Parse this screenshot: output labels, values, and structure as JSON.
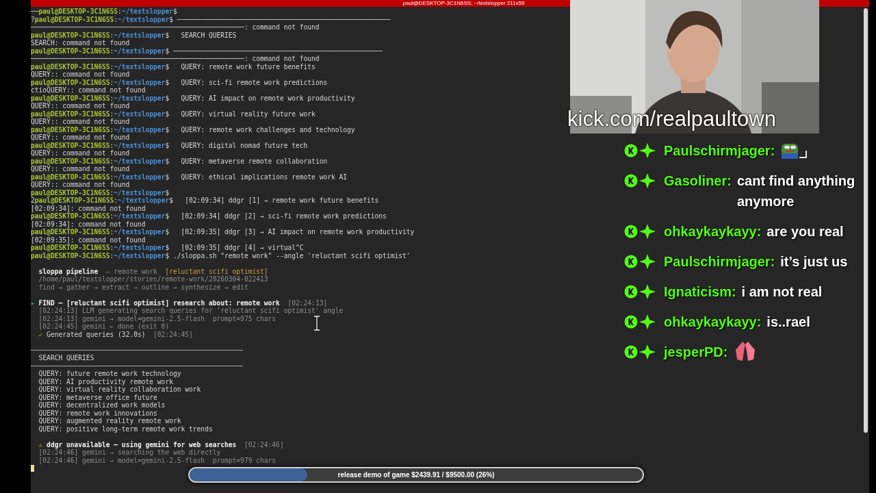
{
  "terminal": {
    "title": "paul@DESKTOP-3C1N6SS: ~/textslopper 211x59",
    "lines": [
      {
        "kind": "text",
        "spans": [
          {
            "kind": "plain",
            "text": "──"
          },
          {
            "kind": "user",
            "text": "paul@DESKTOP-3C1N6SS"
          },
          {
            "kind": "plain",
            "text": ":"
          },
          {
            "kind": "path",
            "text": "~/textslopper"
          },
          {
            "kind": "plain",
            "text": "$"
          }
        ]
      },
      {
        "kind": "text",
        "spans": [
          {
            "kind": "plain",
            "text": "?"
          },
          {
            "kind": "user",
            "text": "paul@DESKTOP-3C1N6SS"
          },
          {
            "kind": "plain",
            "text": ":"
          },
          {
            "kind": "path",
            "text": "~/textslopper"
          },
          {
            "kind": "plain",
            "text": "$ ──────────────────────────────────────────────────────"
          }
        ]
      },
      {
        "kind": "text",
        "spans": [
          {
            "kind": "plain",
            "text": "──────────────────────────────────────────────────────: command not found"
          }
        ]
      },
      {
        "kind": "text",
        "spans": [
          {
            "kind": "user",
            "text": "paul@DESKTOP-3C1N6SS"
          },
          {
            "kind": "plain",
            "text": ":"
          },
          {
            "kind": "path",
            "text": "~/textslopper"
          },
          {
            "kind": "plain",
            "text": "$   SEARCH QUERIES"
          }
        ]
      },
      {
        "kind": "text",
        "spans": [
          {
            "kind": "plain",
            "text": "SEARCH: command not found"
          }
        ]
      },
      {
        "kind": "text",
        "spans": [
          {
            "kind": "user",
            "text": "paul@DESKTOP-3C1N6SS"
          },
          {
            "kind": "plain",
            "text": ":"
          },
          {
            "kind": "path",
            "text": "~/textslopper"
          },
          {
            "kind": "plain",
            "text": "$ ─────────────────────────────────────────────────────"
          }
        ]
      },
      {
        "kind": "text",
        "spans": [
          {
            "kind": "plain",
            "text": "──────────────────────────────────────────────────────: command not found"
          }
        ]
      },
      {
        "kind": "text",
        "spans": [
          {
            "kind": "user",
            "text": "paul@DESKTOP-3C1N6SS"
          },
          {
            "kind": "plain",
            "text": ":"
          },
          {
            "kind": "path",
            "text": "~/textslopper"
          },
          {
            "kind": "plain",
            "text": "$   QUERY: remote work future benefits"
          }
        ]
      },
      {
        "kind": "text",
        "spans": [
          {
            "kind": "plain",
            "text": "QUERY:: command not found"
          }
        ]
      },
      {
        "kind": "text",
        "spans": [
          {
            "kind": "user",
            "text": "paul@DESKTOP-3C1N6SS"
          },
          {
            "kind": "plain",
            "text": ":"
          },
          {
            "kind": "path",
            "text": "~/textslopper"
          },
          {
            "kind": "plain",
            "text": "$   QUERY: sci-fi remote work predictions"
          }
        ]
      },
      {
        "kind": "text",
        "spans": [
          {
            "kind": "plain",
            "text": "ctioQUERY:: command not found"
          }
        ]
      },
      {
        "kind": "text",
        "spans": [
          {
            "kind": "user",
            "text": "paul@DESKTOP-3C1N6SS"
          },
          {
            "kind": "plain",
            "text": ":"
          },
          {
            "kind": "path",
            "text": "~/textslopper"
          },
          {
            "kind": "plain",
            "text": "$   QUERY: AI impact on remote work productivity"
          }
        ]
      },
      {
        "kind": "text",
        "spans": [
          {
            "kind": "plain",
            "text": "QUERY:: command not found"
          }
        ]
      },
      {
        "kind": "text",
        "spans": [
          {
            "kind": "user",
            "text": "paul@DESKTOP-3C1N6SS"
          },
          {
            "kind": "plain",
            "text": ":"
          },
          {
            "kind": "path",
            "text": "~/textslopper"
          },
          {
            "kind": "plain",
            "text": "$   QUERY: virtual reality future work"
          }
        ]
      },
      {
        "kind": "text",
        "spans": [
          {
            "kind": "plain",
            "text": "QUERY:: command not found"
          }
        ]
      },
      {
        "kind": "text",
        "spans": [
          {
            "kind": "user",
            "text": "paul@DESKTOP-3C1N6SS"
          },
          {
            "kind": "plain",
            "text": ":"
          },
          {
            "kind": "path",
            "text": "~/textslopper"
          },
          {
            "kind": "plain",
            "text": "$   QUERY: remote work challenges and technology"
          }
        ]
      },
      {
        "kind": "text",
        "spans": [
          {
            "kind": "plain",
            "text": "QUERY:: command not found"
          }
        ]
      },
      {
        "kind": "text",
        "spans": [
          {
            "kind": "user",
            "text": "paul@DESKTOP-3C1N6SS"
          },
          {
            "kind": "plain",
            "text": ":"
          },
          {
            "kind": "path",
            "text": "~/textslopper"
          },
          {
            "kind": "plain",
            "text": "$   QUERY: digital nomad future tech"
          }
        ]
      },
      {
        "kind": "text",
        "spans": [
          {
            "kind": "plain",
            "text": "QUERY:: command not found"
          }
        ]
      },
      {
        "kind": "text",
        "spans": [
          {
            "kind": "user",
            "text": "paul@DESKTOP-3C1N6SS"
          },
          {
            "kind": "plain",
            "text": ":"
          },
          {
            "kind": "path",
            "text": "~/textslopper"
          },
          {
            "kind": "plain",
            "text": "$   QUERY: metaverse remote collaboration"
          }
        ]
      },
      {
        "kind": "text",
        "spans": [
          {
            "kind": "plain",
            "text": "QUERY:: command not found"
          }
        ]
      },
      {
        "kind": "text",
        "spans": [
          {
            "kind": "user",
            "text": "paul@DESKTOP-3C1N6SS"
          },
          {
            "kind": "plain",
            "text": ":"
          },
          {
            "kind": "path",
            "text": "~/textslopper"
          },
          {
            "kind": "plain",
            "text": "$   QUERY: ethical implications remote work AI"
          }
        ]
      },
      {
        "kind": "text",
        "spans": [
          {
            "kind": "plain",
            "text": "QUERY:: command not found"
          }
        ]
      },
      {
        "kind": "text",
        "spans": [
          {
            "kind": "user",
            "text": "paul@DESKTOP-3C1N6SS"
          },
          {
            "kind": "plain",
            "text": ":"
          },
          {
            "kind": "path",
            "text": "~/textslopper"
          },
          {
            "kind": "plain",
            "text": "$"
          }
        ]
      },
      {
        "kind": "text",
        "spans": [
          {
            "kind": "plain",
            "text": "2"
          },
          {
            "kind": "user",
            "text": "paul@DESKTOP-3C1N6SS"
          },
          {
            "kind": "plain",
            "text": ":"
          },
          {
            "kind": "path",
            "text": "~/textslopper"
          },
          {
            "kind": "plain",
            "text": "$   [02:09:34] ddgr [1] → remote work future benefits"
          }
        ]
      },
      {
        "kind": "text",
        "spans": [
          {
            "kind": "plain",
            "text": "[02:09:34]: command not found"
          }
        ]
      },
      {
        "kind": "text",
        "spans": [
          {
            "kind": "user",
            "text": "paul@DESKTOP-3C1N6SS"
          },
          {
            "kind": "plain",
            "text": ":"
          },
          {
            "kind": "path",
            "text": "~/textslopper"
          },
          {
            "kind": "plain",
            "text": "$   [02:09:34] ddgr [2] → sci-fi remote work predictions"
          }
        ]
      },
      {
        "kind": "text",
        "spans": [
          {
            "kind": "plain",
            "text": "[02:09:34]: command not found"
          }
        ]
      },
      {
        "kind": "text",
        "spans": [
          {
            "kind": "user",
            "text": "paul@DESKTOP-3C1N6SS"
          },
          {
            "kind": "plain",
            "text": ":"
          },
          {
            "kind": "path",
            "text": "~/textslopper"
          },
          {
            "kind": "plain",
            "text": "$   [02:09:35] ddgr [3] → AI impact on remote work productivity"
          }
        ]
      },
      {
        "kind": "text",
        "spans": [
          {
            "kind": "plain",
            "text": "[02:09:35]: command not found"
          }
        ]
      },
      {
        "kind": "text",
        "spans": [
          {
            "kind": "user",
            "text": "paul@DESKTOP-3C1N6SS"
          },
          {
            "kind": "plain",
            "text": ":"
          },
          {
            "kind": "path",
            "text": "~/textslopper"
          },
          {
            "kind": "plain",
            "text": "$   [02:09:35] ddgr [4] → virtual^C"
          }
        ]
      },
      {
        "kind": "text",
        "spans": [
          {
            "kind": "user",
            "text": "paul@DESKTOP-3C1N6SS"
          },
          {
            "kind": "plain",
            "text": ":"
          },
          {
            "kind": "path",
            "text": "~/textslopper"
          },
          {
            "kind": "plain",
            "text": "$ ./sloppa.sh \"remote work\" --angle 'reluctant scifi optimist'"
          }
        ]
      },
      {
        "kind": "blank"
      },
      {
        "kind": "text",
        "spans": [
          {
            "kind": "bold",
            "text": "  sloppa pipeline"
          },
          {
            "kind": "dim",
            "text": "  — remote work  "
          },
          {
            "kind": "accent",
            "text": "[reluctant scifi optimist]"
          }
        ]
      },
      {
        "kind": "text",
        "spans": [
          {
            "kind": "dim",
            "text": "  /home/paul/textslopper/stories/remote-work/20260304-022413"
          }
        ]
      },
      {
        "kind": "text",
        "spans": [
          {
            "kind": "dim",
            "text": "  find → gather → extract → outline → synthesize → edit"
          }
        ]
      },
      {
        "kind": "blank"
      },
      {
        "kind": "text",
        "spans": [
          {
            "kind": "marker",
            "text": "▸ "
          },
          {
            "kind": "bold",
            "text": "FIND — [reluctant scifi optimist] research about: remote work"
          },
          {
            "kind": "dim",
            "text": "  [02:24:13]"
          }
        ]
      },
      {
        "kind": "text",
        "spans": [
          {
            "kind": "dim",
            "text": "  [02:24:13] LLM generating search queries for 'reluctant scifi optimist' angle"
          }
        ]
      },
      {
        "kind": "text",
        "spans": [
          {
            "kind": "dim",
            "text": "  [02:24:13] gemini → model=gemini-2.5-flash  prompt=975 chars"
          }
        ]
      },
      {
        "kind": "text",
        "spans": [
          {
            "kind": "dim",
            "text": "  [02:24:45] gemini ← done (exit 0)"
          }
        ]
      },
      {
        "kind": "text",
        "spans": [
          {
            "kind": "accent",
            "text": "  ✓ "
          },
          {
            "kind": "plain",
            "text": "Generated queries (32.0s)"
          },
          {
            "kind": "dim",
            "text": "  [02:24:45]"
          }
        ]
      },
      {
        "kind": "blank"
      },
      {
        "kind": "rule"
      },
      {
        "kind": "text",
        "spans": [
          {
            "kind": "plain",
            "text": "  SEARCH QUERIES"
          }
        ]
      },
      {
        "kind": "rule"
      },
      {
        "kind": "text",
        "spans": [
          {
            "kind": "plain",
            "text": "  QUERY: future remote work technology"
          }
        ]
      },
      {
        "kind": "text",
        "spans": [
          {
            "kind": "plain",
            "text": "  QUERY: AI productivity remote work"
          }
        ]
      },
      {
        "kind": "text",
        "spans": [
          {
            "kind": "plain",
            "text": "  QUERY: virtual reality collaboration work"
          }
        ]
      },
      {
        "kind": "text",
        "spans": [
          {
            "kind": "plain",
            "text": "  QUERY: metaverse office future"
          }
        ]
      },
      {
        "kind": "text",
        "spans": [
          {
            "kind": "plain",
            "text": "  QUERY: decentralized work models"
          }
        ]
      },
      {
        "kind": "text",
        "spans": [
          {
            "kind": "plain",
            "text": "  QUERY: remote work innovations"
          }
        ]
      },
      {
        "kind": "text",
        "spans": [
          {
            "kind": "plain",
            "text": "  QUERY: augmented reality remote work"
          }
        ]
      },
      {
        "kind": "text",
        "spans": [
          {
            "kind": "plain",
            "text": "  QUERY: positive long-term remote work trends"
          }
        ]
      },
      {
        "kind": "blank"
      },
      {
        "kind": "text",
        "spans": [
          {
            "kind": "accent",
            "text": "  ⚠ "
          },
          {
            "kind": "bold",
            "text": "ddgr unavailable — using gemini for web searches"
          },
          {
            "kind": "dim",
            "text": "  [02:24:46]"
          }
        ]
      },
      {
        "kind": "text",
        "spans": [
          {
            "kind": "dim",
            "text": "  [02:24:46] gemini → searching the web directly"
          }
        ]
      },
      {
        "kind": "text",
        "spans": [
          {
            "kind": "dim",
            "text": "  [02:24:46] gemini → model=gemini-2.5-flash  prompt=979 chars"
          }
        ]
      },
      {
        "kind": "cursor"
      }
    ]
  },
  "webcam": {
    "kind": "picture",
    "caption": "kick.com/realpaultown"
  },
  "chat": [
    {
      "user": "Paulschirmjager:",
      "kind": "frog"
    },
    {
      "user": "Gasoliner:",
      "kind": "text",
      "text": "cant find anything anymore"
    },
    {
      "user": "ohkaykaykayy:",
      "kind": "text",
      "text": "are you real"
    },
    {
      "user": "Paulschirmjager:",
      "kind": "text",
      "text": "it’s just us"
    },
    {
      "user": "Ignaticism:",
      "kind": "text",
      "text": "i am not real"
    },
    {
      "user": "ohkaykaykayy:",
      "kind": "text",
      "text": "is..rael"
    },
    {
      "user": "jesperPD:",
      "kind": "hands"
    }
  ],
  "goal": {
    "label": "release demo of game $2439.91 / $9500.00 (26%)",
    "level": 0.26
  }
}
